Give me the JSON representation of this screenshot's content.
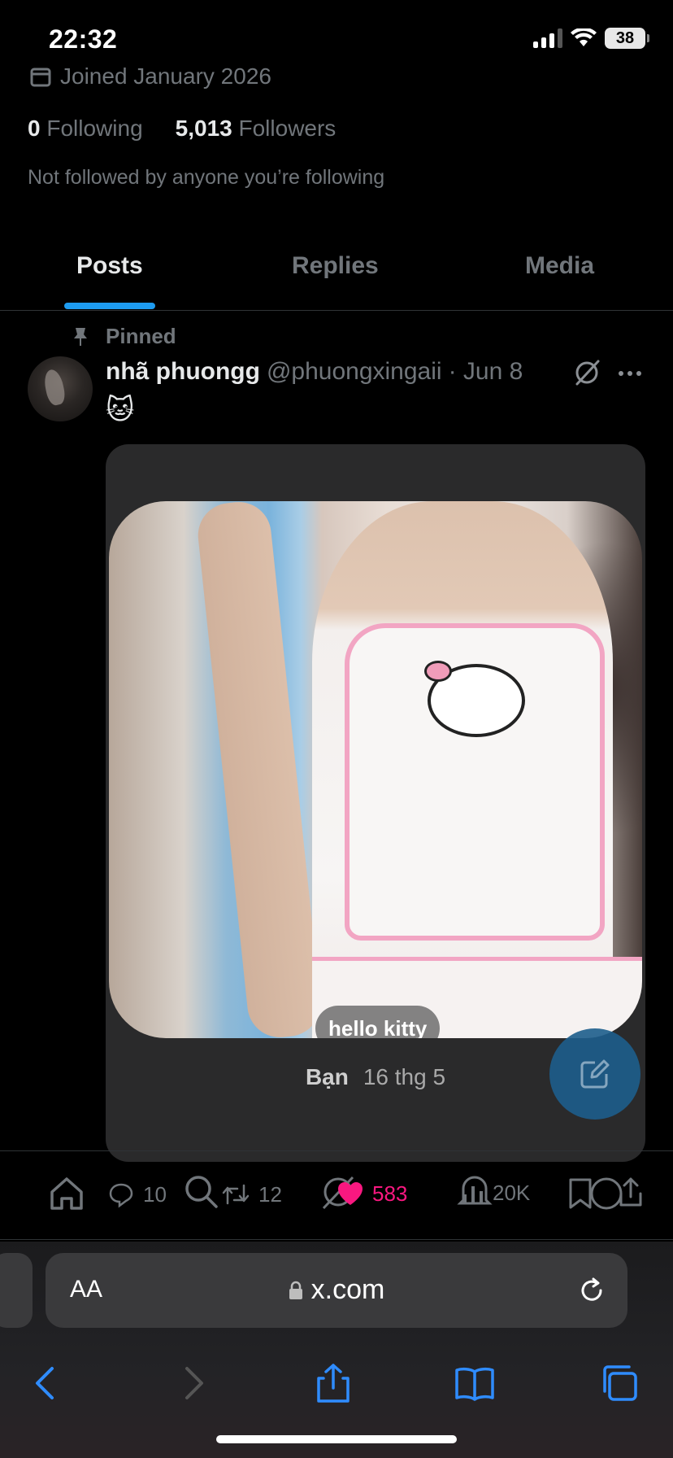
{
  "status_bar": {
    "time": "22:32",
    "battery": "38"
  },
  "profile": {
    "joined": "Joined January 2026",
    "following_count": "0",
    "following_label": "Following",
    "followers_count": "5,013",
    "followers_label": "Followers",
    "not_followed": "Not followed by anyone you’re following"
  },
  "tabs": [
    {
      "label": "Posts",
      "active": true
    },
    {
      "label": "Replies",
      "active": false
    },
    {
      "label": "Media",
      "active": false
    }
  ],
  "post": {
    "pinned_label": "Pinned",
    "name": "nhã phuongg",
    "handle": "@phuongxingaii",
    "date": "· Jun 8",
    "text": "🐱",
    "media": {
      "caption": "hello kitty",
      "story_author": "Bạn",
      "story_date": "16 thg 5"
    },
    "stats": {
      "replies": "10",
      "reposts": "12",
      "likes": "583",
      "views": "20K"
    }
  },
  "browser": {
    "aa_label": "AA",
    "url": "x.com"
  },
  "colors": {
    "accent": "#1d9bf0",
    "like": "#f91880",
    "muted": "#71767b"
  }
}
